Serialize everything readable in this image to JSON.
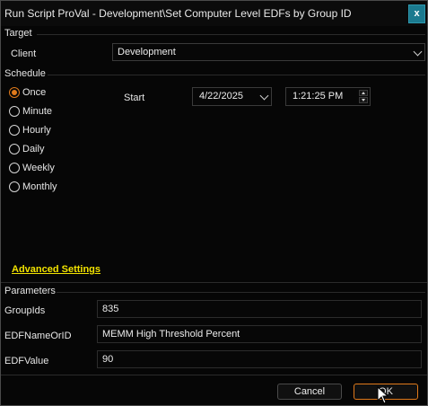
{
  "window": {
    "title": "Run Script ProVal - Development\\Set Computer Level EDFs by Group ID",
    "close_label": "x"
  },
  "target": {
    "section_label": "Target",
    "client_label": "Client",
    "client_value": "Development"
  },
  "schedule": {
    "section_label": "Schedule",
    "options": [
      {
        "label": "Once",
        "checked": true
      },
      {
        "label": "Minute",
        "checked": false
      },
      {
        "label": "Hourly",
        "checked": false
      },
      {
        "label": "Daily",
        "checked": false
      },
      {
        "label": "Weekly",
        "checked": false
      },
      {
        "label": "Monthly",
        "checked": false
      }
    ],
    "start_label": "Start",
    "start_date": "4/22/2025",
    "start_time": "1:21:25 PM"
  },
  "advanced_settings_label": "Advanced Settings",
  "parameters": {
    "section_label": "Parameters",
    "fields": [
      {
        "label": "GroupIds",
        "value": "835"
      },
      {
        "label": "EDFNameOrID",
        "value": "MEMM High Threshold Percent"
      },
      {
        "label": "EDFValue",
        "value": "90"
      }
    ]
  },
  "buttons": {
    "cancel": "Cancel",
    "ok": "OK"
  },
  "colors": {
    "accent": "#e07a1b",
    "link": "#f2e300",
    "close": "#1b7a8f",
    "background": "#060606"
  }
}
